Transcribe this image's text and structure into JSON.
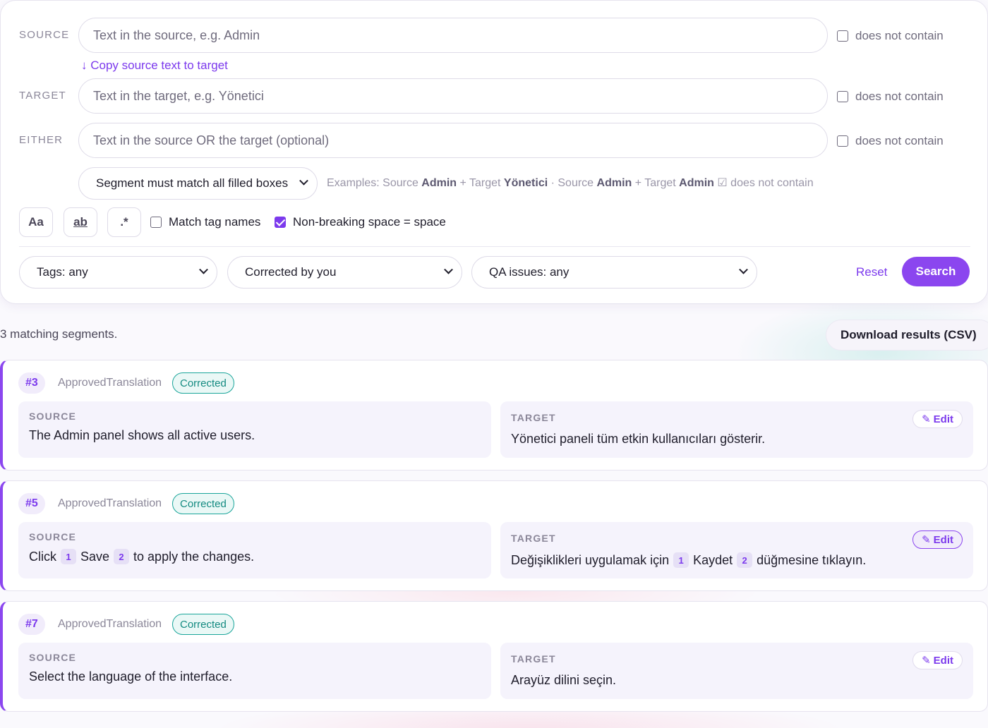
{
  "search": {
    "rows": [
      {
        "label": "SOURCE",
        "placeholder": "Text in the source, e.g. Admin",
        "negate_label": "does not contain",
        "negate_checked": false
      },
      {
        "label": "TARGET",
        "placeholder": "Text in the target, e.g. Yönetici",
        "negate_label": "does not contain",
        "negate_checked": false
      },
      {
        "label": "EITHER",
        "placeholder": "Text in the source OR the target (optional)",
        "negate_label": "does not contain",
        "negate_checked": false
      }
    ],
    "copy_link": "↓ Copy source text to target",
    "match_mode": "Segment must match all filled boxes",
    "examples": {
      "prefix": "Examples: Source ",
      "ex1_source": "Admin",
      "ex1_mid": " + Target ",
      "ex1_target": "Yönetici",
      "sep": " · Source ",
      "ex2_source": "Admin",
      "ex2_mid": " + Target ",
      "ex2_target": "Admin",
      "suffix": " ☑ does not contain"
    },
    "options": {
      "case_label": "Aa",
      "word_label": "ab",
      "regex_label": ".*",
      "match_tags_label": "Match tag names",
      "match_tags_checked": false,
      "nbsp_label": "Non-breaking space = space",
      "nbsp_checked": true
    },
    "filters": {
      "tags": "Tags: any",
      "corrected": "Corrected by you",
      "qa": "QA issues: any"
    },
    "reset_label": "Reset",
    "search_label": "Search"
  },
  "results": {
    "summary": "3 matching segments.",
    "download_label": "Download results (CSV)",
    "source_label": "SOURCE",
    "target_label": "TARGET",
    "edit_label": "Edit",
    "segments": [
      {
        "id": "#3",
        "status": "ApprovedTranslation",
        "badge": "Corrected",
        "source_text": "The Admin panel shows all active users.",
        "target_text": "Yönetici paneli tüm etkin kullanıcıları gösterir."
      },
      {
        "id": "#5",
        "status": "ApprovedTranslation",
        "badge": "Corrected",
        "source_parts": [
          "Click",
          "1",
          "Save",
          "2",
          "to apply the changes."
        ],
        "target_parts": [
          "Değişiklikleri uygulamak için",
          "1",
          "Kaydet",
          "2",
          "düğmesine tıklayın."
        ]
      },
      {
        "id": "#7",
        "status": "ApprovedTranslation",
        "badge": "Corrected",
        "source_text": "Select the language of the interface.",
        "target_text": "Arayüz dilini seçin."
      }
    ]
  },
  "colors": {
    "accent": "#7c3aed",
    "accent_button": "#8b46ef",
    "badge_teal": "#1aa59a"
  }
}
